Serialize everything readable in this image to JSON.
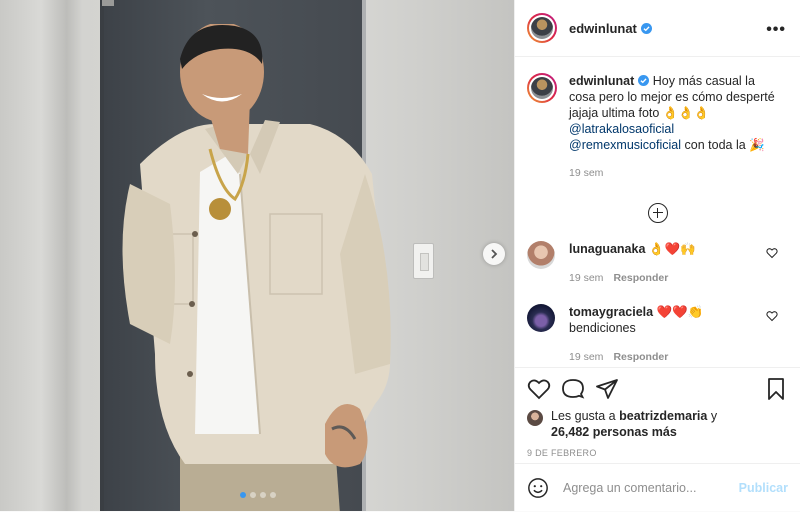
{
  "post": {
    "username": "edwinlunat",
    "caption_text": "Hoy más casual la cosa pero lo mejor es cómo desperté jajaja ultima foto 👌👌👌",
    "mention1": "@latrakalosaoficial",
    "mention2": "@remexmusicoficial",
    "caption_tail": "con toda la 🎉",
    "caption_time": "19 sem",
    "carousel_total": 4,
    "carousel_active": 1
  },
  "comments": [
    {
      "user": "lunaguanaka",
      "text": "👌❤️🙌",
      "time": "19 sem",
      "reply": "Responder"
    },
    {
      "user": "tomaygraciela",
      "text": "❤️❤️👏",
      "text2": "bendiciones",
      "time": "19 sem",
      "reply": "Responder"
    }
  ],
  "likes": {
    "prefix": "Les gusta a",
    "user": "beatrizdemaria",
    "conj": "y",
    "count": "26,482 personas más"
  },
  "date": "9 DE FEBRERO",
  "add_comment": {
    "placeholder": "Agrega un comentario...",
    "publish": "Publicar"
  },
  "colors": {
    "link": "#00376b",
    "verified": "#3897f0",
    "muted": "#8e8e8e",
    "publish_disabled": "#b2dffc"
  },
  "icons": [
    "verified-icon",
    "more-options-icon",
    "load-more-icon",
    "heart-icon",
    "comment-icon",
    "share-icon",
    "bookmark-icon",
    "emoji-icon",
    "next-arrow-icon"
  ]
}
